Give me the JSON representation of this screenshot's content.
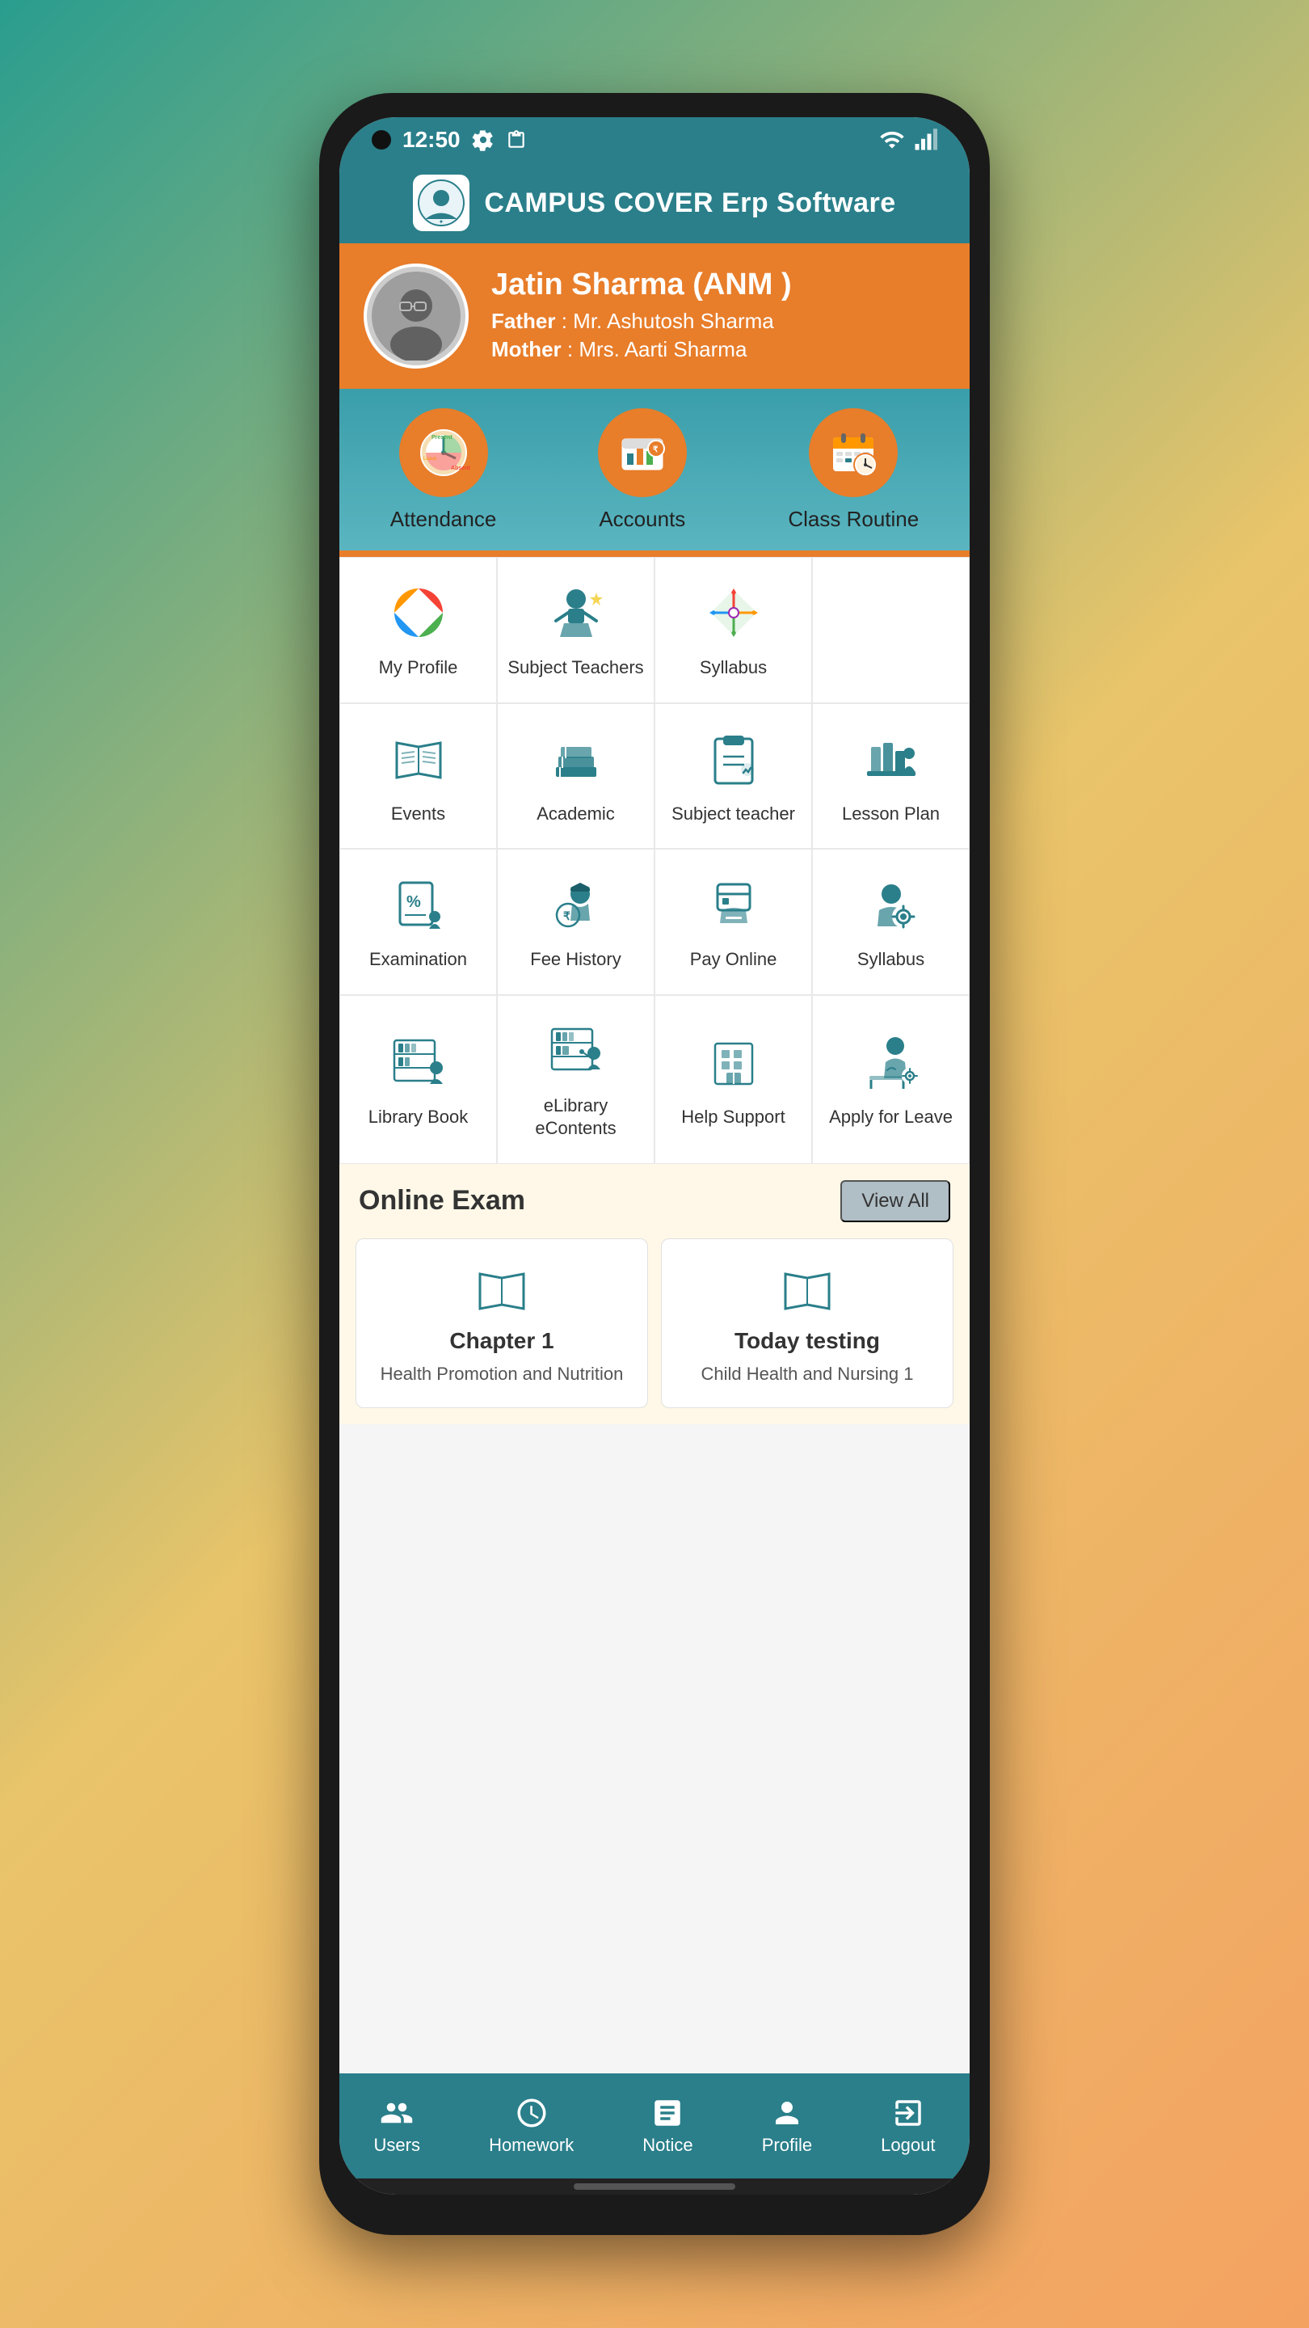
{
  "statusBar": {
    "time": "12:50",
    "settingsIcon": "gear-icon",
    "clipboardIcon": "clipboard-icon",
    "wifiIcon": "wifi-icon",
    "signalIcon": "signal-icon"
  },
  "header": {
    "title": "CAMPUS COVER Erp Software",
    "logoAlt": "campus-cover-logo"
  },
  "profile": {
    "name": "Jatin Sharma (ANM )",
    "fatherLabel": "Father",
    "fatherName": "Mr. Ashutosh Sharma",
    "motherLabel": "Mother",
    "motherName": "Mrs. Aarti Sharma"
  },
  "quickActions": [
    {
      "label": "Attendance",
      "icon": "attendance-icon"
    },
    {
      "label": "Accounts",
      "icon": "accounts-icon"
    },
    {
      "label": "Class Routine",
      "icon": "class-routine-icon"
    }
  ],
  "menuItems": [
    {
      "label": "My Profile",
      "icon": "my-profile-icon"
    },
    {
      "label": "Subject\nTeachers",
      "icon": "subject-teachers-icon"
    },
    {
      "label": "Syllabus",
      "icon": "syllabus-icon"
    },
    {
      "label": "",
      "icon": ""
    },
    {
      "label": "Events",
      "icon": "events-icon"
    },
    {
      "label": "Academic",
      "icon": "academic-icon"
    },
    {
      "label": "Subject teacher",
      "icon": "subject-teacher-icon"
    },
    {
      "label": "Lesson Plan",
      "icon": "lesson-plan-icon"
    },
    {
      "label": "Examination",
      "icon": "examination-icon"
    },
    {
      "label": "Fee History",
      "icon": "fee-history-icon"
    },
    {
      "label": "Pay Online",
      "icon": "pay-online-icon"
    },
    {
      "label": "Syllabus",
      "icon": "syllabus2-icon"
    },
    {
      "label": "Library\nBook",
      "icon": "library-book-icon"
    },
    {
      "label": "eLibrary\neContents",
      "icon": "elibrary-icon"
    },
    {
      "label": "Help\nSupport",
      "icon": "help-support-icon"
    },
    {
      "label": "Apply\nfor Leave",
      "icon": "apply-leave-icon"
    }
  ],
  "onlineExam": {
    "title": "Online Exam",
    "viewAllLabel": "View All",
    "cards": [
      {
        "title": "Chapter 1",
        "subject": "Health Promotion and Nutrition"
      },
      {
        "title": "Today testing",
        "subject": "Child Health and Nursing 1"
      }
    ]
  },
  "bottomNav": [
    {
      "label": "Users",
      "icon": "users-icon"
    },
    {
      "label": "Homework",
      "icon": "homework-icon"
    },
    {
      "label": "Notice",
      "icon": "notice-icon"
    },
    {
      "label": "Profile",
      "icon": "profile-icon"
    },
    {
      "label": "Logout",
      "icon": "logout-icon"
    }
  ]
}
